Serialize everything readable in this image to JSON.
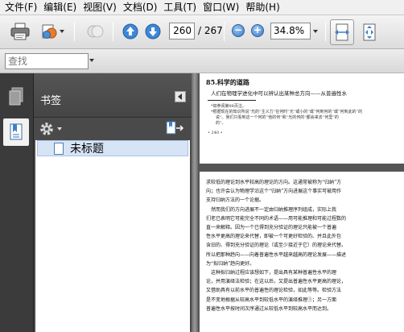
{
  "menubar": {
    "items": [
      "文件(F)",
      "编辑(E)",
      "视图(V)",
      "文档(D)",
      "工具(T)",
      "窗口(W)",
      "帮助(H)"
    ]
  },
  "toolbar": {
    "page_current": "260",
    "page_total": "/ 267",
    "zoom_value": "34.8%",
    "zoom_out_symbol": "−",
    "zoom_in_symbol": "+"
  },
  "findbar": {
    "placeholder": "查找"
  },
  "panel": {
    "title": "书签",
    "bookmarks": [
      {
        "label": "未标题"
      }
    ]
  },
  "document": {
    "page1": {
      "header": "85.科学的道路",
      "subtitle": "人们在物理学进化中可以辨认出某种总方向——从普遍性水",
      "notes": [
        "*如参阅第88页注。",
        "*根据现在的知识所说“光的”主义力”在何时“光”或小的”或“何到何的”或“何到此的”的",
        "说”。我们只看到这一个何的“他的何”和“光的何的”都会来去“何里”的",
        "的”。"
      ],
      "page_number": "• 240 •"
    },
    "page2": {
      "lines": [
        "求较低的理论到水平较高的理论的方向。这通常被称为“归纳”方",
        "向；也许会认为物理学沿这个“归纳”方向进展这个事实可被用作",
        "支持归纳方法的一个论据。",
        "　然而我们的方向进展不一定由归纳推理序列组成，实际上我",
        "们老已表明它可能完全不同的术语——用可能推理和可能过程数的",
        "直一来解释。因为一个已得到充分验证的理论只能被一个普遍",
        "性水平更高的理论来代替，即被一个可更好检验的、并且此外包",
        "含旧的、得到充分验证的理论（或至少接近于它）的理论来代替。",
        "所以把那种趋向——向着普遍性水平越来越高的理论发展——描述",
        "为“拟归纳”趋向更好。",
        "　这种拟归纳过程应该想如下，提出具有某种普遍性水平的理",
        "论，并用演绎法检验；在这以后，又提出普遍性水平更高的理论，",
        "又借助具有以前水平的普遍性的理论检验，如此等等。检验方法",
        "是不变地根据从较高水平到较低水平的演绎推理①；另一方面",
        "普遍性水平按时间次序通过从较低水平到较高水平而达到。"
      ]
    }
  }
}
